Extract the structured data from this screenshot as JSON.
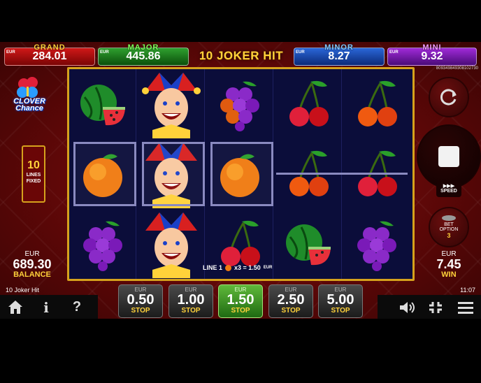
{
  "jackpots": {
    "grand": {
      "name": "GRAND",
      "value": "284.01",
      "currency": "EUR"
    },
    "major": {
      "name": "MAJOR",
      "value": "445.86",
      "currency": "EUR"
    },
    "minor": {
      "name": "MINOR",
      "value": "8.27",
      "currency": "EUR"
    },
    "mini": {
      "name": "MINI",
      "value": "9.32",
      "currency": "EUR"
    }
  },
  "game_title": "10 JOKER HIT",
  "ticket_id": "809349849308102730",
  "logo": {
    "line1": "CLOVER",
    "line2": "Chance"
  },
  "lines": {
    "count": "10",
    "label1": "LINES",
    "label2": "FIXED"
  },
  "balance": {
    "currency": "EUR",
    "value": "689.30",
    "label": "BALANCE"
  },
  "win": {
    "currency": "EUR",
    "value": "7.45",
    "label": "WIN"
  },
  "win_line": {
    "line": "LINE 1",
    "multiplier": "x3 = 1.50",
    "currency": "EUR"
  },
  "reels": [
    [
      "watermelon",
      "orange",
      "grapes"
    ],
    [
      "joker",
      "joker",
      "joker"
    ],
    [
      "grapes",
      "orange",
      "cherries"
    ],
    [
      "cherries",
      "cherries",
      "watermelon"
    ],
    [
      "cherries",
      "cherries",
      "grapes"
    ]
  ],
  "controls": {
    "speed_label": "SPEED",
    "bet_option_label1": "BET",
    "bet_option_label2": "OPTION",
    "bet_option_value": "3"
  },
  "footer": {
    "game_name": "10 Joker Hit",
    "clock": "11:07"
  },
  "bets": [
    {
      "currency": "EUR",
      "amount": "0.50",
      "action": "STOP",
      "active": false
    },
    {
      "currency": "EUR",
      "amount": "1.00",
      "action": "STOP",
      "active": false
    },
    {
      "currency": "EUR",
      "amount": "1.50",
      "action": "STOP",
      "active": true
    },
    {
      "currency": "EUR",
      "amount": "2.50",
      "action": "STOP",
      "active": false
    },
    {
      "currency": "EUR",
      "amount": "5.00",
      "action": "STOP",
      "active": false
    }
  ],
  "toolbar": {
    "home_icon": "home-icon",
    "info_label": "i",
    "help_label": "?",
    "sound_icon": "speaker-icon",
    "fullscreen_icon": "fullscreen-icon",
    "menu_icon": "hamburger-menu-icon"
  }
}
